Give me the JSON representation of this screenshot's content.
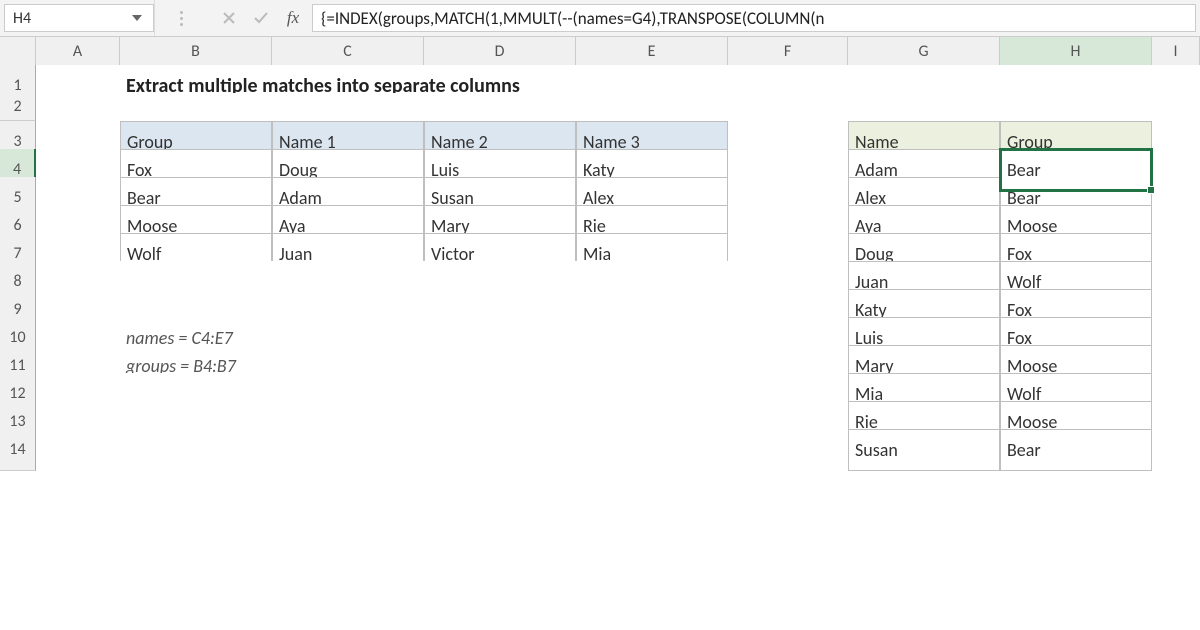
{
  "name_box": "H4",
  "formula_bar": "{=INDEX(groups,MATCH(1,MMULT(--(names=G4),TRANSPOSE(COLUMN(n",
  "columns": [
    "A",
    "B",
    "C",
    "D",
    "E",
    "F",
    "G",
    "H",
    "I"
  ],
  "row_numbers": [
    "1",
    "2",
    "3",
    "4",
    "5",
    "6",
    "7",
    "8",
    "9",
    "10",
    "11",
    "12",
    "13",
    "14"
  ],
  "title": "Extract multiple matches into separate columns",
  "table1": {
    "headers": [
      "Group",
      "Name 1",
      "Name 2",
      "Name 3"
    ],
    "rows": [
      [
        "Fox",
        "Doug",
        "Luis",
        "Katy"
      ],
      [
        "Bear",
        "Adam",
        "Susan",
        "Alex"
      ],
      [
        "Moose",
        "Aya",
        "Mary",
        "Rie"
      ],
      [
        "Wolf",
        "Juan",
        "Victor",
        "Mia"
      ]
    ]
  },
  "table2": {
    "headers": [
      "Name",
      "Group"
    ],
    "rows": [
      [
        "Adam",
        "Bear"
      ],
      [
        "Alex",
        "Bear"
      ],
      [
        "Aya",
        "Moose"
      ],
      [
        "Doug",
        "Fox"
      ],
      [
        "Juan",
        "Wolf"
      ],
      [
        "Katy",
        "Fox"
      ],
      [
        "Luis",
        "Fox"
      ],
      [
        "Mary",
        "Moose"
      ],
      [
        "Mia",
        "Wolf"
      ],
      [
        "Rie",
        "Moose"
      ],
      [
        "Susan",
        "Bear"
      ]
    ]
  },
  "notes": {
    "names_def": "names = C4:E7",
    "groups_def": "groups = B4:B7"
  },
  "selected_cell": "H4",
  "selected_value": "Bear"
}
